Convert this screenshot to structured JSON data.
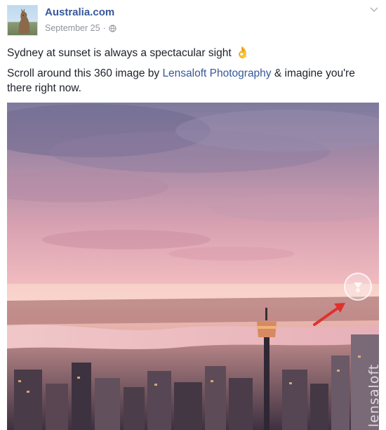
{
  "post": {
    "page_name": "Australia.com",
    "date": "September 25",
    "separator": "·",
    "privacy_icon": "globe-icon",
    "menu_icon": "chevron-down-icon",
    "line1_text": "Sydney at sunset is always a spectacular sight",
    "line1_emoji": "👌",
    "body_prefix": "Scroll around this 360 image by ",
    "body_link": "Lensaloft Photography",
    "body_suffix": " & imagine you're there right now.",
    "image": {
      "subject": "aerial sunset view of Sydney with Sydney Tower",
      "viewer_icon": "360-viewer-icon",
      "annotation": "red-arrow",
      "watermark": "lensaloft"
    }
  },
  "colors": {
    "link": "#365899",
    "text": "#1d2129",
    "meta": "#90949c",
    "arrow": "#e0312e"
  }
}
